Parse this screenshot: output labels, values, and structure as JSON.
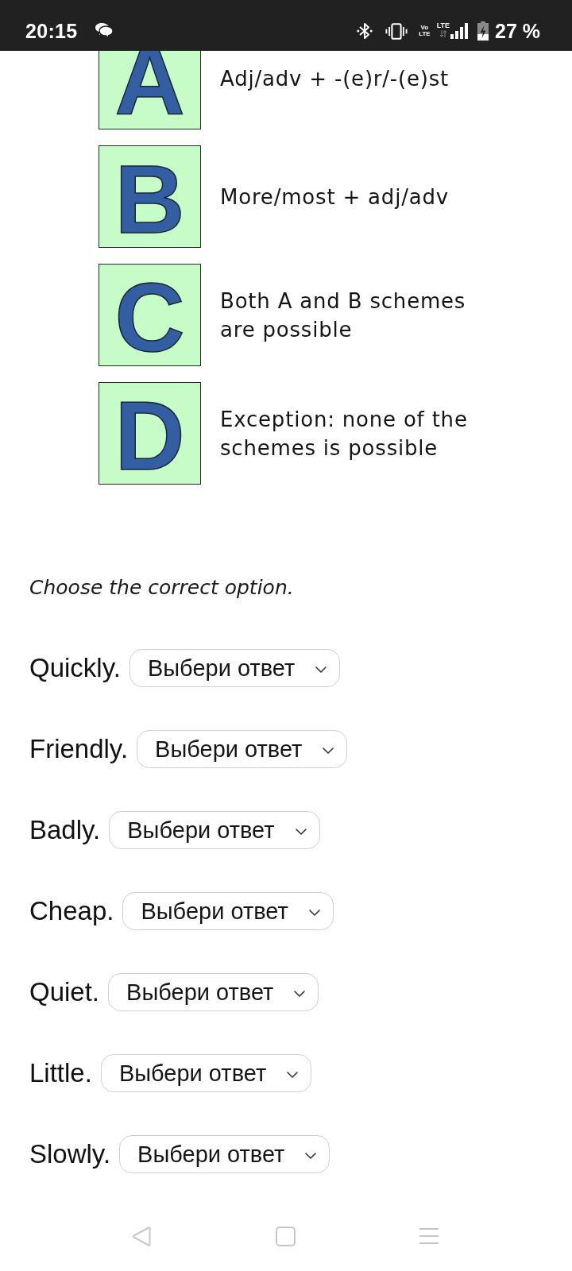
{
  "status_bar": {
    "time": "20:15",
    "volte": [
      "Vo",
      "LTE"
    ],
    "network": "LTE",
    "battery": "27 %"
  },
  "legend": [
    {
      "letter": "A",
      "description": "Adj/adv + -(e)r/-(e)st"
    },
    {
      "letter": "B",
      "description": "More/most + adj/adv"
    },
    {
      "letter": "C",
      "description": "Both A and B schemes are possible"
    },
    {
      "letter": "D",
      "description": "Exception: none of the schemes is possible"
    }
  ],
  "instruction": "Choose the correct option.",
  "questions": [
    {
      "word": "Quickly.",
      "answer": {
        "value": "Выбери ответ"
      }
    },
    {
      "word": "Friendly.",
      "answer": {
        "value": "Выбери ответ"
      }
    },
    {
      "word": "Badly.",
      "answer": {
        "value": "Выбери ответ"
      }
    },
    {
      "word": "Cheap.",
      "answer": {
        "value": "Выбери ответ"
      }
    },
    {
      "word": "Quiet.",
      "answer": {
        "value": "Выбери ответ"
      }
    },
    {
      "word": "Little.",
      "answer": {
        "value": "Выбери ответ"
      }
    },
    {
      "word": "Slowly.",
      "answer": {
        "value": "Выбери ответ"
      }
    }
  ]
}
